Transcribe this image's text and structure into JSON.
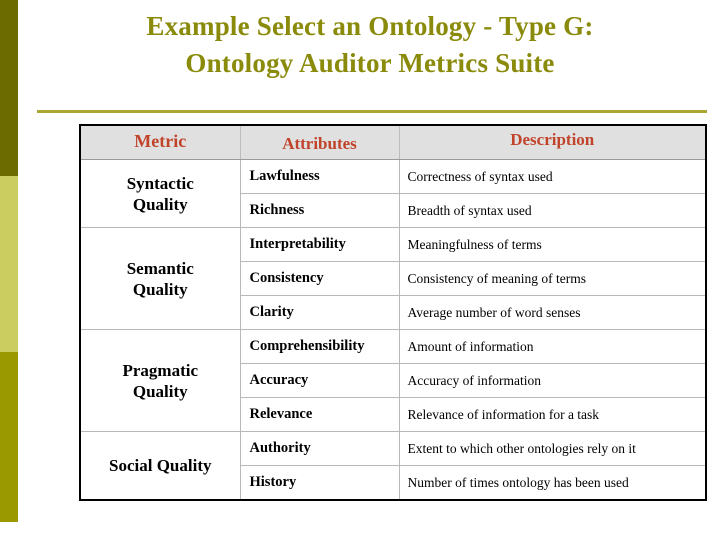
{
  "slide": {
    "title_lines": [
      "Example Select an Ontology - Type G:",
      "Ontology Auditor Metrics Suite"
    ],
    "title_color": "#8a8a0b",
    "rule_color": "#a8a830",
    "header_text_color": "#c0432a",
    "header_bg_color": "#e0e0e0"
  },
  "sidebar": {
    "bands": [
      {
        "name": "band-top",
        "color": "#6b6b00"
      },
      {
        "name": "band-mid",
        "color": "#cbcd61"
      },
      {
        "name": "band-bottom",
        "color": "#9a9a00"
      }
    ]
  },
  "table": {
    "headers": {
      "metric": "Metric",
      "attributes": "Attributes",
      "description": "Description"
    },
    "groups": [
      {
        "metric": "Syntactic\nQuality",
        "metric_line1": "Syntactic",
        "metric_line2": "Quality",
        "rows": [
          {
            "attribute": "Lawfulness",
            "description": "Correctness of syntax used"
          },
          {
            "attribute": "Richness",
            "description": "Breadth of syntax used"
          }
        ]
      },
      {
        "metric_line1": "Semantic",
        "metric_line2": "Quality",
        "rows": [
          {
            "attribute": "Interpretability",
            "description": "Meaningfulness of terms"
          },
          {
            "attribute": "Consistency",
            "description": "Consistency of meaning of terms"
          },
          {
            "attribute": "Clarity",
            "description": "Average number of word senses"
          }
        ]
      },
      {
        "metric_line1": "Pragmatic",
        "metric_line2": "Quality",
        "rows": [
          {
            "attribute": "Comprehensibility",
            "description": "Amount of information"
          },
          {
            "attribute": "Accuracy",
            "description": "Accuracy of information"
          },
          {
            "attribute": "Relevance",
            "description": "Relevance of information for a task"
          }
        ]
      },
      {
        "metric_line1": "Social Quality",
        "metric_line2": "",
        "rows": [
          {
            "attribute": "Authority",
            "description": "Extent to which other ontologies rely on it"
          },
          {
            "attribute": "History",
            "description": "Number of times ontology has been used"
          }
        ]
      }
    ]
  }
}
